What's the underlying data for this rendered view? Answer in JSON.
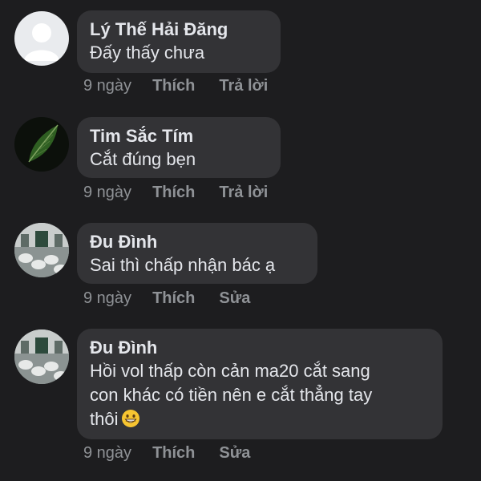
{
  "comments": [
    {
      "author": "Lý Thế Hải Đăng",
      "lines": [
        "Đấy thấy chưa"
      ],
      "time": "9 ngày",
      "actions": [
        "Thích",
        "Trả lời"
      ],
      "avatar": "default-avatar"
    },
    {
      "author": "Tim Sắc Tím",
      "lines": [
        "Cắt đúng bẹn"
      ],
      "time": "9 ngày",
      "actions": [
        "Thích",
        "Trả lời"
      ],
      "avatar": "leaf-avatar"
    },
    {
      "author": "Đu Đình",
      "lines": [
        "Sai thì chấp nhận bác ạ"
      ],
      "time": "9 ngày",
      "actions": [
        "Thích",
        "Sửa"
      ],
      "avatar": "room-avatar"
    },
    {
      "author": "Đu Đình",
      "lines": [
        "Hồi vol thấp còn cản ma20 cắt sang",
        "con khác có tiền nên e cắt thẳng tay",
        "thôi"
      ],
      "emoji": "grinning-face-emoji",
      "time": "9 ngày",
      "actions": [
        "Thích",
        "Sửa"
      ],
      "avatar": "room-avatar"
    }
  ],
  "colors": {
    "background": "#1d1d1f",
    "bubble": "#333336",
    "text": "#e4e6eb",
    "meta": "#8f9296"
  }
}
